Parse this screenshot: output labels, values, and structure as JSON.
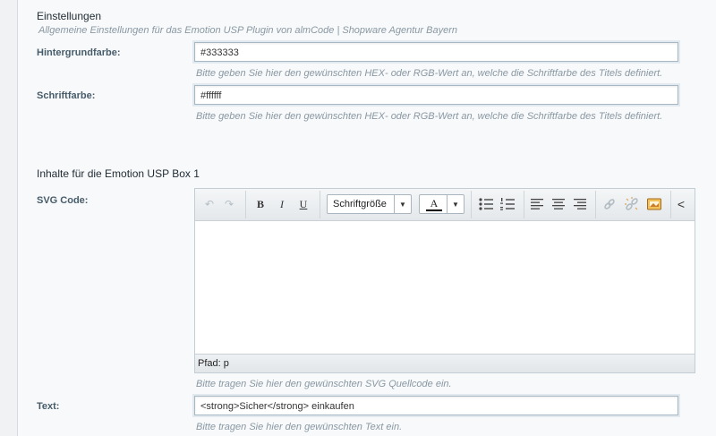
{
  "settings": {
    "legend": "Einstellungen",
    "description": "Allgemeine Einstellungen für das Emotion USP Plugin von almCode | Shopware Agentur Bayern",
    "background_color": {
      "label": "Hintergrundfarbe:",
      "value": "#333333",
      "help": "Bitte geben Sie hier den gewünschten HEX- oder RGB-Wert an, welche die Schriftfarbe des Titels definiert."
    },
    "font_color": {
      "label": "Schriftfarbe:",
      "value": "#ffffff",
      "help": "Bitte geben Sie hier den gewünschten HEX- oder RGB-Wert an, welche die Schriftfarbe des Titels definiert."
    }
  },
  "box1": {
    "legend": "Inhalte für die Emotion USP Box 1",
    "svg": {
      "label": "SVG Code:",
      "font_size_label": "Schriftgröße",
      "font_color_letter": "A",
      "path_label": "Pfad: p",
      "help": "Bitte tragen Sie hier den gewünschten SVG Quellcode ein."
    },
    "text": {
      "label": "Text:",
      "value": "<strong>Sicher</strong> einkaufen",
      "help": "Bitte tragen Sie hier den gewünschten Text ein."
    }
  },
  "toolbar_icons": {
    "undo": "↶",
    "redo": "↷",
    "bold": "B",
    "italic": "I",
    "underline": "U",
    "dropdown": "▼",
    "more": "<"
  },
  "colors": {
    "font_color_bar": "#000000"
  }
}
